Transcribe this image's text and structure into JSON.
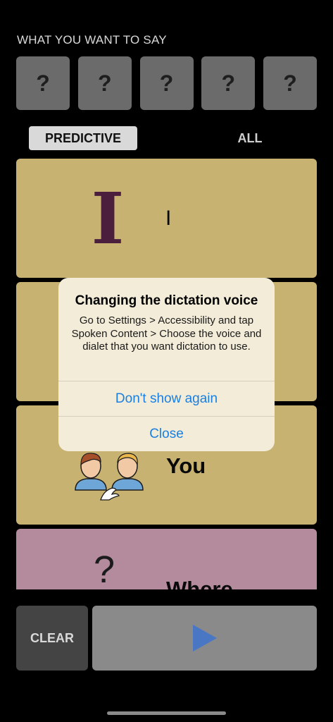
{
  "header": {
    "label": "WHAT YOU WANT TO SAY"
  },
  "slots": [
    "?",
    "?",
    "?",
    "?",
    "?"
  ],
  "tabs": {
    "predictive": "PREDICTIVE",
    "all": "ALL"
  },
  "cards": [
    {
      "symbol": "I",
      "label": "I",
      "color": "#c7b271"
    },
    {
      "label": "",
      "color": "#c7b271"
    },
    {
      "label": "You",
      "color": "#c7b271",
      "icon": "two-people-talking-icon"
    },
    {
      "symbol": "?",
      "label": "Where",
      "color": "#b38b9d"
    }
  ],
  "controls": {
    "clear_label": "CLEAR",
    "play_icon": "play-icon"
  },
  "alert": {
    "title": "Changing the dictation voice",
    "message": "Go to Settings > Accessibility and tap Spoken Content > Choose the voice and dialet that you want dictation to use.",
    "primary_action": "Don't show again",
    "secondary_action": "Close",
    "action_color": "#1a7fe0"
  },
  "colors": {
    "background": "#000000",
    "slot": "#6b6b6b",
    "card_yellow": "#c7b271",
    "card_pink": "#b38b9d",
    "symbol_purple": "#4a1e3c",
    "play_blue": "#4a77c4"
  }
}
